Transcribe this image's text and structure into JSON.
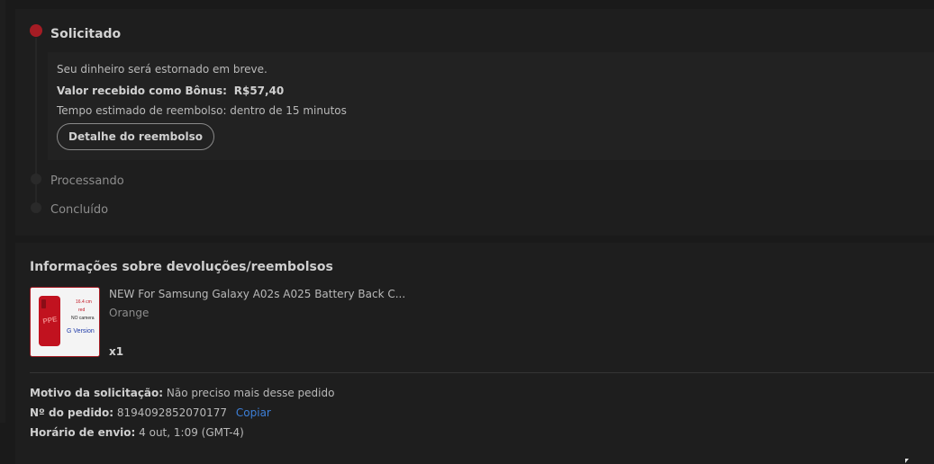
{
  "timeline": {
    "steps": [
      {
        "label": "Solicitado"
      },
      {
        "label": "Processando"
      },
      {
        "label": "Concluído"
      }
    ],
    "detail": {
      "message": "Seu dinheiro será estornado em breve.",
      "bonus_label": "Valor recebido como Bônus:",
      "bonus_value": "R$57,40",
      "estimate": "Tempo estimado de reembolso: dentro de 15 minutos",
      "button_label": "Detalhe do reembolso"
    }
  },
  "info": {
    "title": "Informações sobre devoluções/reembolsos",
    "product": {
      "name": "NEW For Samsung Galaxy A02s A025 Battery Back C...",
      "variant": "Orange",
      "quantity": "x1",
      "image_text": {
        "size": "16.4 cm",
        "color": "red",
        "camera": "NO camera",
        "version": "G Version"
      }
    },
    "reason_label": "Motivo da solicitação:",
    "reason_value": "Não preciso mais desse pedido",
    "order_label": "Nº do pedido:",
    "order_value": "8194092852070177",
    "copy_label": "Copiar",
    "ship_label": "Horário de envio:",
    "ship_value": "4 out, 1:09 (GMT-4)"
  },
  "colors": {
    "accent": "#a51c24",
    "link": "#3d7fd8",
    "background": "#1a1a1a",
    "card": "#1e1e1e"
  }
}
